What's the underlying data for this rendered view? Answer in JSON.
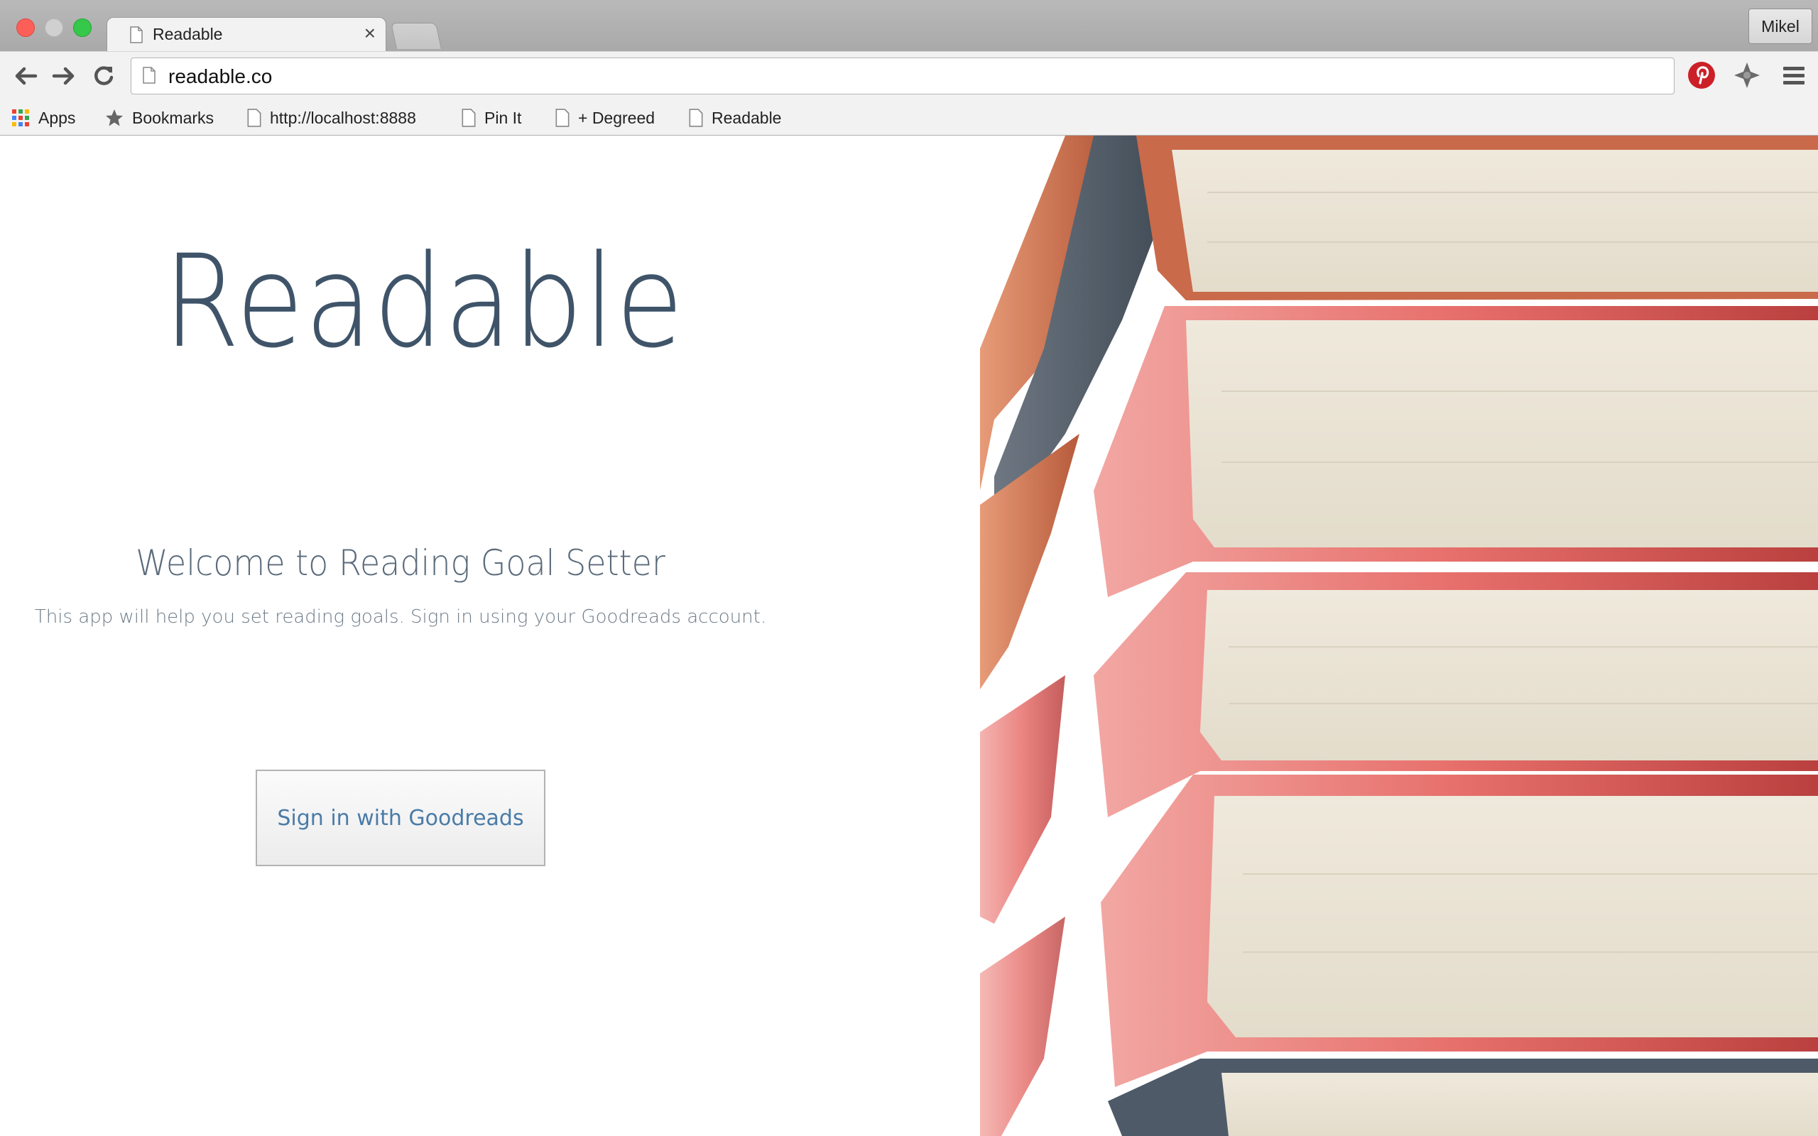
{
  "browser": {
    "tab_title": "Readable",
    "tab_close": "×",
    "profile_name": "Mikel",
    "url": "readable.co",
    "bookmarks": [
      {
        "label": "Apps"
      },
      {
        "label": "Bookmarks"
      },
      {
        "label": "http://localhost:8888"
      },
      {
        "label": "Pin It"
      },
      {
        "label": "+ Degreed"
      },
      {
        "label": "Readable"
      }
    ],
    "colors": {
      "pinterest": "#cb2027",
      "accent_link": "#4a7ba8"
    }
  },
  "page": {
    "logo": "Readable",
    "welcome_heading": "Welcome to Reading Goal Setter",
    "description": "This app will help you set reading goals. Sign in using your Goodreads account.",
    "signin_button": "Sign in with Goodreads",
    "hero_image": "stack-of-books-image"
  }
}
